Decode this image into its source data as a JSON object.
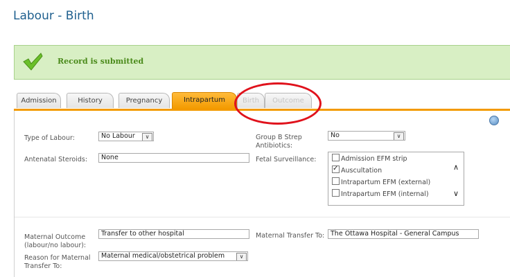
{
  "page": {
    "title": "Labour - Birth"
  },
  "banner": {
    "message": "Record is submitted"
  },
  "tabs": [
    {
      "label": "Admission",
      "state": "normal"
    },
    {
      "label": "History",
      "state": "normal"
    },
    {
      "label": "Pregnancy",
      "state": "normal"
    },
    {
      "label": "Intrapartum",
      "state": "active"
    },
    {
      "label": "Birth",
      "state": "disabled"
    },
    {
      "label": "Outcome",
      "state": "disabled"
    }
  ],
  "form": {
    "type_of_labour": {
      "label": "Type of Labour:",
      "value": "No Labour"
    },
    "group_b_strep": {
      "label": "Group B Strep Antibiotics:",
      "value": "No"
    },
    "antenatal_steroids": {
      "label": "Antenatal Steroids:",
      "value": "None"
    },
    "fetal_surveillance": {
      "label": "Fetal Surveillance:",
      "options": [
        {
          "label": "Admission EFM strip",
          "checked": false
        },
        {
          "label": "Auscultation",
          "checked": true
        },
        {
          "label": "Intrapartum EFM (external)",
          "checked": false
        },
        {
          "label": "Intrapartum EFM (internal)",
          "checked": false
        }
      ]
    },
    "maternal_outcome": {
      "label": "Maternal Outcome (labour/no labour):",
      "value": "Transfer to other hospital"
    },
    "maternal_transfer_to": {
      "label": "Maternal Transfer To:",
      "value": "The Ottawa Hospital - General Campus"
    },
    "reason_for_transfer": {
      "label": "Reason for Maternal Transfer To:",
      "value": "Maternal medical/obstetrical problem"
    }
  },
  "colors": {
    "accent_tab": "#f39a00",
    "banner_bg": "#d8efc4",
    "highlight_oval": "#e0121c",
    "title": "#1e5f8e"
  },
  "icons": {
    "banner": "checkmark-icon",
    "help": "help-icon"
  }
}
